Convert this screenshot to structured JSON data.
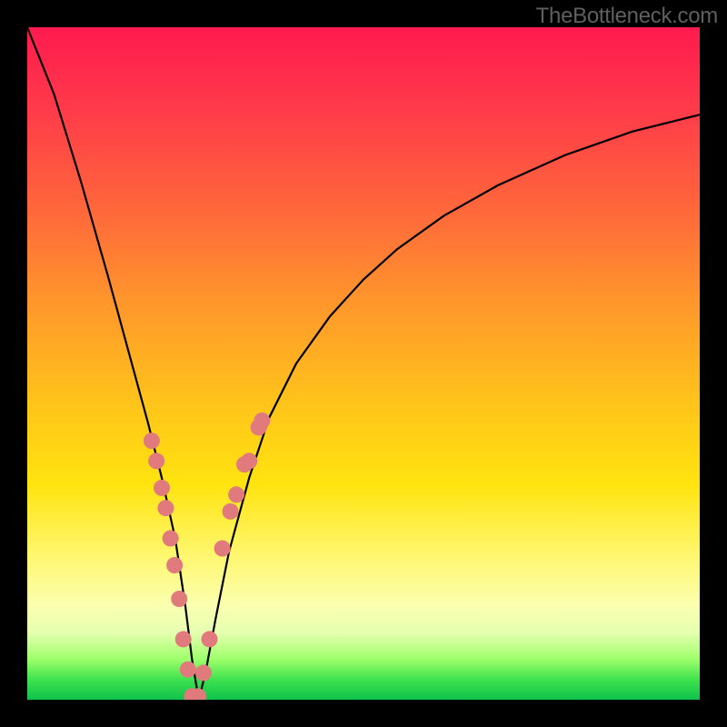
{
  "watermark": "TheBottleneck.com",
  "chart_data": {
    "type": "line",
    "title": "",
    "xlabel": "",
    "ylabel": "",
    "xlim": [
      0,
      100
    ],
    "ylim": [
      0,
      100
    ],
    "series": [
      {
        "name": "curve",
        "x": [
          0,
          4,
          8,
          12,
          15,
          18,
          20,
          22,
          23.5,
          24.5,
          25.5,
          26.5,
          28,
          30,
          33,
          36,
          40,
          45,
          50,
          55,
          62,
          70,
          80,
          90,
          100
        ],
        "y": [
          100,
          90,
          77,
          63,
          52,
          41,
          33,
          24,
          14,
          6,
          0,
          4,
          12,
          22,
          33,
          42,
          50,
          57,
          62.5,
          67,
          72,
          76.5,
          81,
          84.5,
          87
        ]
      }
    ],
    "dots": {
      "name": "markers",
      "color": "#e07a7d",
      "x": [
        18.5,
        19.2,
        20.0,
        20.6,
        21.3,
        21.9,
        22.6,
        23.2,
        23.9,
        24.5,
        25.4,
        26.2,
        27.1,
        29.0,
        30.2,
        31.1,
        32.3,
        33.0,
        34.4,
        34.9
      ],
      "y": [
        38.5,
        35.5,
        31.5,
        28.5,
        24.0,
        20.0,
        15.0,
        9.0,
        4.5,
        0.5,
        0.5,
        4.0,
        9.0,
        22.5,
        28.0,
        30.5,
        35.0,
        35.5,
        40.5,
        41.5
      ]
    },
    "gradient_stops": [
      {
        "pos": 0,
        "color": "#ff1a4e"
      },
      {
        "pos": 28,
        "color": "#ff6a3a"
      },
      {
        "pos": 56,
        "color": "#ffc41a"
      },
      {
        "pos": 86,
        "color": "#fbffb0"
      },
      {
        "pos": 100,
        "color": "#0fc24b"
      }
    ]
  }
}
